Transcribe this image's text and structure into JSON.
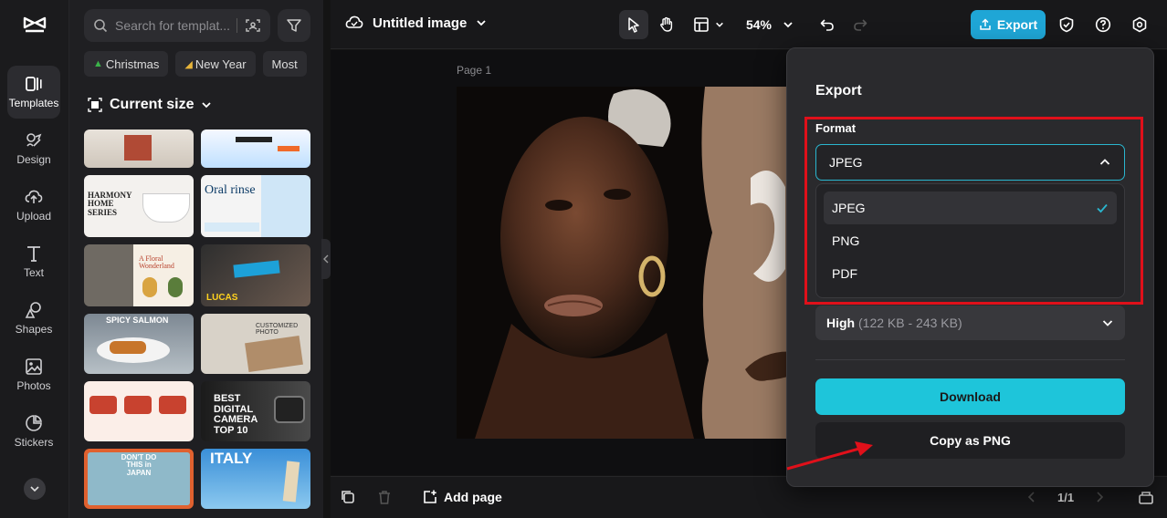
{
  "rail": {
    "items": [
      {
        "label": "Templates",
        "icon": "templates-icon",
        "active": true
      },
      {
        "label": "Design",
        "icon": "design-icon"
      },
      {
        "label": "Upload",
        "icon": "upload-icon"
      },
      {
        "label": "Text",
        "icon": "text-icon"
      },
      {
        "label": "Shapes",
        "icon": "shapes-icon"
      },
      {
        "label": "Photos",
        "icon": "photos-icon"
      },
      {
        "label": "Stickers",
        "icon": "stickers-icon"
      }
    ]
  },
  "panel": {
    "search_placeholder": "Search for templat...",
    "chips": [
      "Christmas",
      "New Year",
      "Most"
    ],
    "size_heading": "Current size",
    "thumbs": [
      {
        "text": ""
      },
      {
        "text": ""
      },
      {
        "text": "HARMONY HOME SERIES"
      },
      {
        "text": "Oral rinse"
      },
      {
        "text": "A Floral Wonderland"
      },
      {
        "text": "LUCAS"
      },
      {
        "text": "SPICY SALMON"
      },
      {
        "text": "CUSTOMIZED PHOTO"
      },
      {
        "text": ""
      },
      {
        "text": "BEST DIGITAL CAMERA TOP 10"
      },
      {
        "text": "DON'T DO THIS in JAPAN"
      },
      {
        "text": "ITALY"
      }
    ]
  },
  "topbar": {
    "title": "Untitled image",
    "zoom": "54%",
    "export_label": "Export"
  },
  "canvas": {
    "page_label": "Page 1"
  },
  "bottombar": {
    "add_page": "Add page",
    "page_count": "1/1"
  },
  "export_popup": {
    "title": "Export",
    "format_label": "Format",
    "selected_format": "JPEG",
    "options": [
      "JPEG",
      "PNG",
      "PDF"
    ],
    "quality": "High",
    "quality_size": "(122 KB - 243 KB)",
    "download_label": "Download",
    "copy_label": "Copy as PNG"
  },
  "colors": {
    "accent": "#1ec5da",
    "export_button": "#1fa6d6",
    "annotation": "#e0101a"
  }
}
